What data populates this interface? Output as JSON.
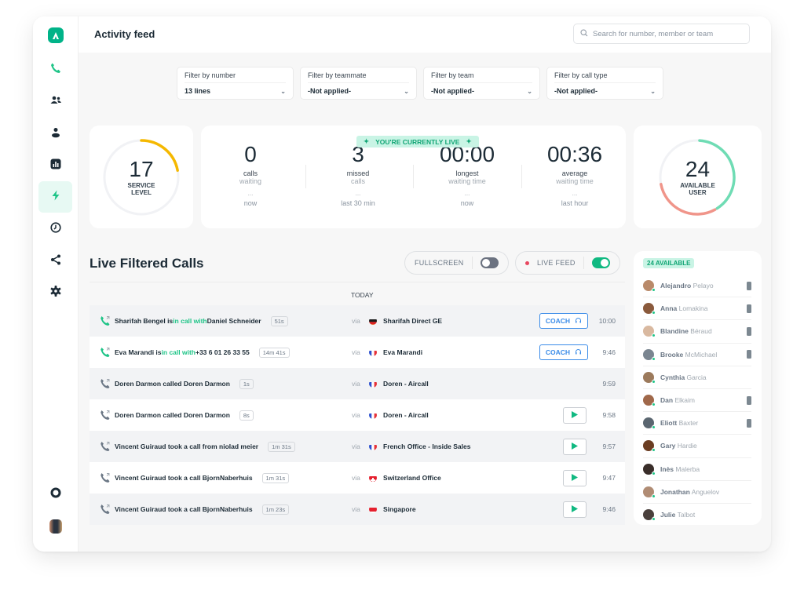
{
  "app": {
    "title": "Activity feed",
    "accent_color": "#00b388",
    "search": {
      "placeholder": "Search for number, member or team",
      "value": ""
    }
  },
  "sidebar": {
    "items": [
      {
        "name": "phone-icon",
        "label": "Calls",
        "active": false
      },
      {
        "name": "people-icon",
        "label": "Teams",
        "active": false
      },
      {
        "name": "user-icon",
        "label": "Users",
        "active": false
      },
      {
        "name": "bar-chart-icon",
        "label": "Analytics",
        "active": false
      },
      {
        "name": "lightning-icon",
        "label": "Activity feed",
        "active": true
      },
      {
        "name": "clock-icon",
        "label": "History",
        "active": false
      },
      {
        "name": "share-icon",
        "label": "Integrations",
        "active": false
      },
      {
        "name": "gear-icon",
        "label": "Settings",
        "active": false
      }
    ],
    "bottom": [
      {
        "name": "lifebuoy-icon",
        "label": "Help"
      },
      {
        "name": "avatar",
        "label": "Profile"
      }
    ]
  },
  "filters": [
    {
      "label": "Filter by number",
      "value": "13 lines"
    },
    {
      "label": "Filter by teammate",
      "value": "-Not applied-"
    },
    {
      "label": "Filter by team",
      "value": "-Not applied-"
    },
    {
      "label": "Filter by call type",
      "value": "-Not applied-"
    }
  ],
  "service_level": {
    "value": "17",
    "label_line1": "SERVICE",
    "label_line2": "LEVEL",
    "percent": 17,
    "color": "#f5b800"
  },
  "live_badge": "YOU'RE CURRENTLY LIVE",
  "stats": [
    {
      "value": "0",
      "line1": "calls",
      "line2": "waiting",
      "dots": "...",
      "when": "now"
    },
    {
      "value": "3",
      "line1": "missed",
      "line2": "calls",
      "dots": "...",
      "when": "last 30 min"
    },
    {
      "value": "00:00",
      "line1": "longest",
      "line2": "waiting time",
      "dots": "...",
      "when": "now"
    },
    {
      "value": "00:36",
      "line1": "average",
      "line2": "waiting time",
      "dots": "...",
      "when": "last hour"
    }
  ],
  "available_users": {
    "value": "24",
    "label_line1": "AVAILABLE",
    "label_line2": "USER",
    "available_fraction": 0.4,
    "busy_fraction": 0.3,
    "available_color": "#6fdcb4",
    "busy_color": "#f0958a"
  },
  "live_calls": {
    "title": "Live Filtered Calls",
    "fullscreen": {
      "label": "FULLSCREEN",
      "on": false
    },
    "live_feed": {
      "label": "LIVE FEED",
      "on": true
    },
    "day_label": "TODAY",
    "rows": [
      {
        "who": "Sharifah Bengel is ",
        "status": "in call with",
        "other": " Daniel Schneider",
        "duration": "51s",
        "via": "via",
        "flag": "de",
        "line": "Sharifah Direct GE",
        "action": "coach",
        "action_label": "COACH",
        "time": "10:00",
        "active": true
      },
      {
        "who": "Eva Marandi is ",
        "status": "in call with",
        "other": " +33 6 01 26 33 55",
        "duration": "14m 41s",
        "via": "via",
        "flag": "fr",
        "line": "Eva Marandi",
        "action": "coach",
        "action_label": "COACH",
        "time": "9:46",
        "active": true
      },
      {
        "who": "Doren Darmon called  Doren Darmon",
        "status": "",
        "other": "",
        "duration": "1s",
        "via": "via",
        "flag": "fr",
        "line": "Doren - Aircall",
        "action": "none",
        "action_label": "",
        "time": "9:59",
        "active": false
      },
      {
        "who": "Doren Darmon called  Doren Darmon",
        "status": "",
        "other": "",
        "duration": "8s",
        "via": "via",
        "flag": "fr",
        "line": "Doren - Aircall",
        "action": "play",
        "action_label": "",
        "time": "9:58",
        "active": false
      },
      {
        "who": "Vincent Guiraud took a call from niolad meier",
        "status": "",
        "other": "",
        "duration": "1m 31s",
        "via": "via",
        "flag": "fr",
        "line": "French Office - Inside Sales",
        "action": "play",
        "action_label": "",
        "time": "9:57",
        "active": false
      },
      {
        "who": "Vincent Guiraud took a call BjornNaberhuis",
        "status": "",
        "other": "",
        "duration": "1m 31s",
        "via": "via",
        "flag": "ch",
        "line": "Switzerland Office",
        "action": "play",
        "action_label": "",
        "time": "9:47",
        "active": false
      },
      {
        "who": "Vincent Guiraud took a call BjornNaberhuis",
        "status": "",
        "other": "",
        "duration": "1m 23s",
        "via": "via",
        "flag": "sg",
        "line": "Singapore",
        "action": "play",
        "action_label": "",
        "time": "9:46",
        "active": false
      }
    ]
  },
  "users_panel": {
    "badge": "24 AVAILABLE",
    "users": [
      {
        "first": "Alejandro",
        "last": "Pelayo",
        "device": true,
        "avatar_color": "#b98a6a"
      },
      {
        "first": "Anna",
        "last": "Lomakina",
        "device": true,
        "avatar_color": "#8a5a3c"
      },
      {
        "first": "Blandine",
        "last": "Béraud",
        "device": true,
        "avatar_color": "#d9b9a0"
      },
      {
        "first": "Brooke",
        "last": "McMichael",
        "device": true,
        "avatar_color": "#7a8590"
      },
      {
        "first": "Cynthia",
        "last": "Garcia",
        "device": false,
        "avatar_color": "#9c7a5c"
      },
      {
        "first": "Dan",
        "last": "Elkaim",
        "device": true,
        "avatar_color": "#a0684a"
      },
      {
        "first": "Eliott",
        "last": "Baxter",
        "device": true,
        "avatar_color": "#5a6670"
      },
      {
        "first": "Gary",
        "last": "Hardie",
        "device": false,
        "avatar_color": "#6b3d22"
      },
      {
        "first": "Inès",
        "last": "Malerba",
        "device": false,
        "avatar_color": "#3a2e2a"
      },
      {
        "first": "Jonathan",
        "last": "Anguelov",
        "device": false,
        "avatar_color": "#b08c74"
      },
      {
        "first": "Julie",
        "last": "Talbot",
        "device": false,
        "avatar_color": "#4a403c"
      }
    ]
  }
}
